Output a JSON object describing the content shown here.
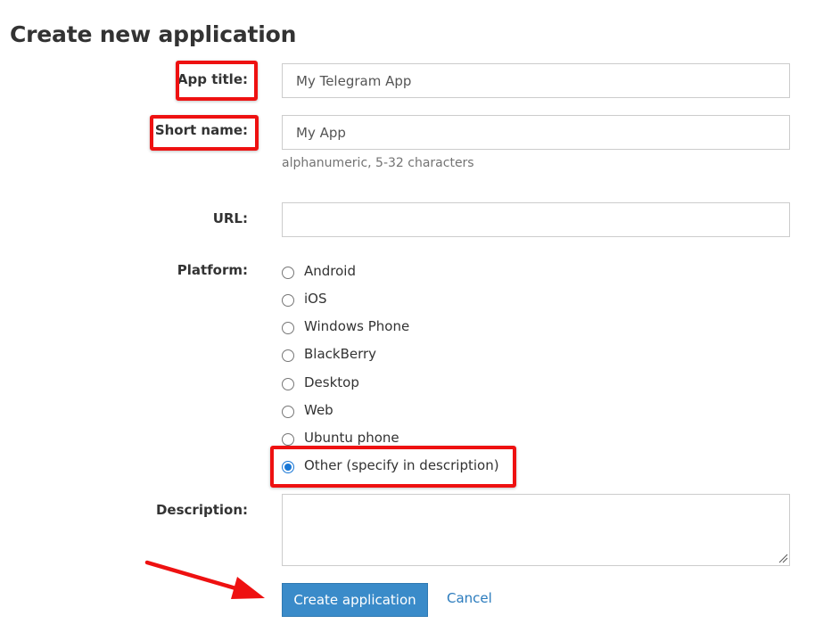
{
  "page": {
    "title": "Create new application"
  },
  "form": {
    "app_title": {
      "label": "App title:",
      "value": "My Telegram App"
    },
    "short_name": {
      "label": "Short name:",
      "value": "My App",
      "help": "alphanumeric, 5-32 characters"
    },
    "url": {
      "label": "URL:",
      "value": ""
    },
    "platform": {
      "label": "Platform:",
      "options": [
        "Android",
        "iOS",
        "Windows Phone",
        "BlackBerry",
        "Desktop",
        "Web",
        "Ubuntu phone",
        "Other (specify in description)"
      ],
      "selected": "Other (specify in description)"
    },
    "description": {
      "label": "Description:",
      "value": ""
    },
    "submit_label": "Create application",
    "cancel_label": "Cancel"
  },
  "annotations": {
    "highlight_color": "#ee1111",
    "arrow_color": "#ee1111"
  },
  "colors": {
    "primary_button": "#3a8bc9",
    "link": "#2a7bbd",
    "radio_selected": "#1877d6"
  }
}
